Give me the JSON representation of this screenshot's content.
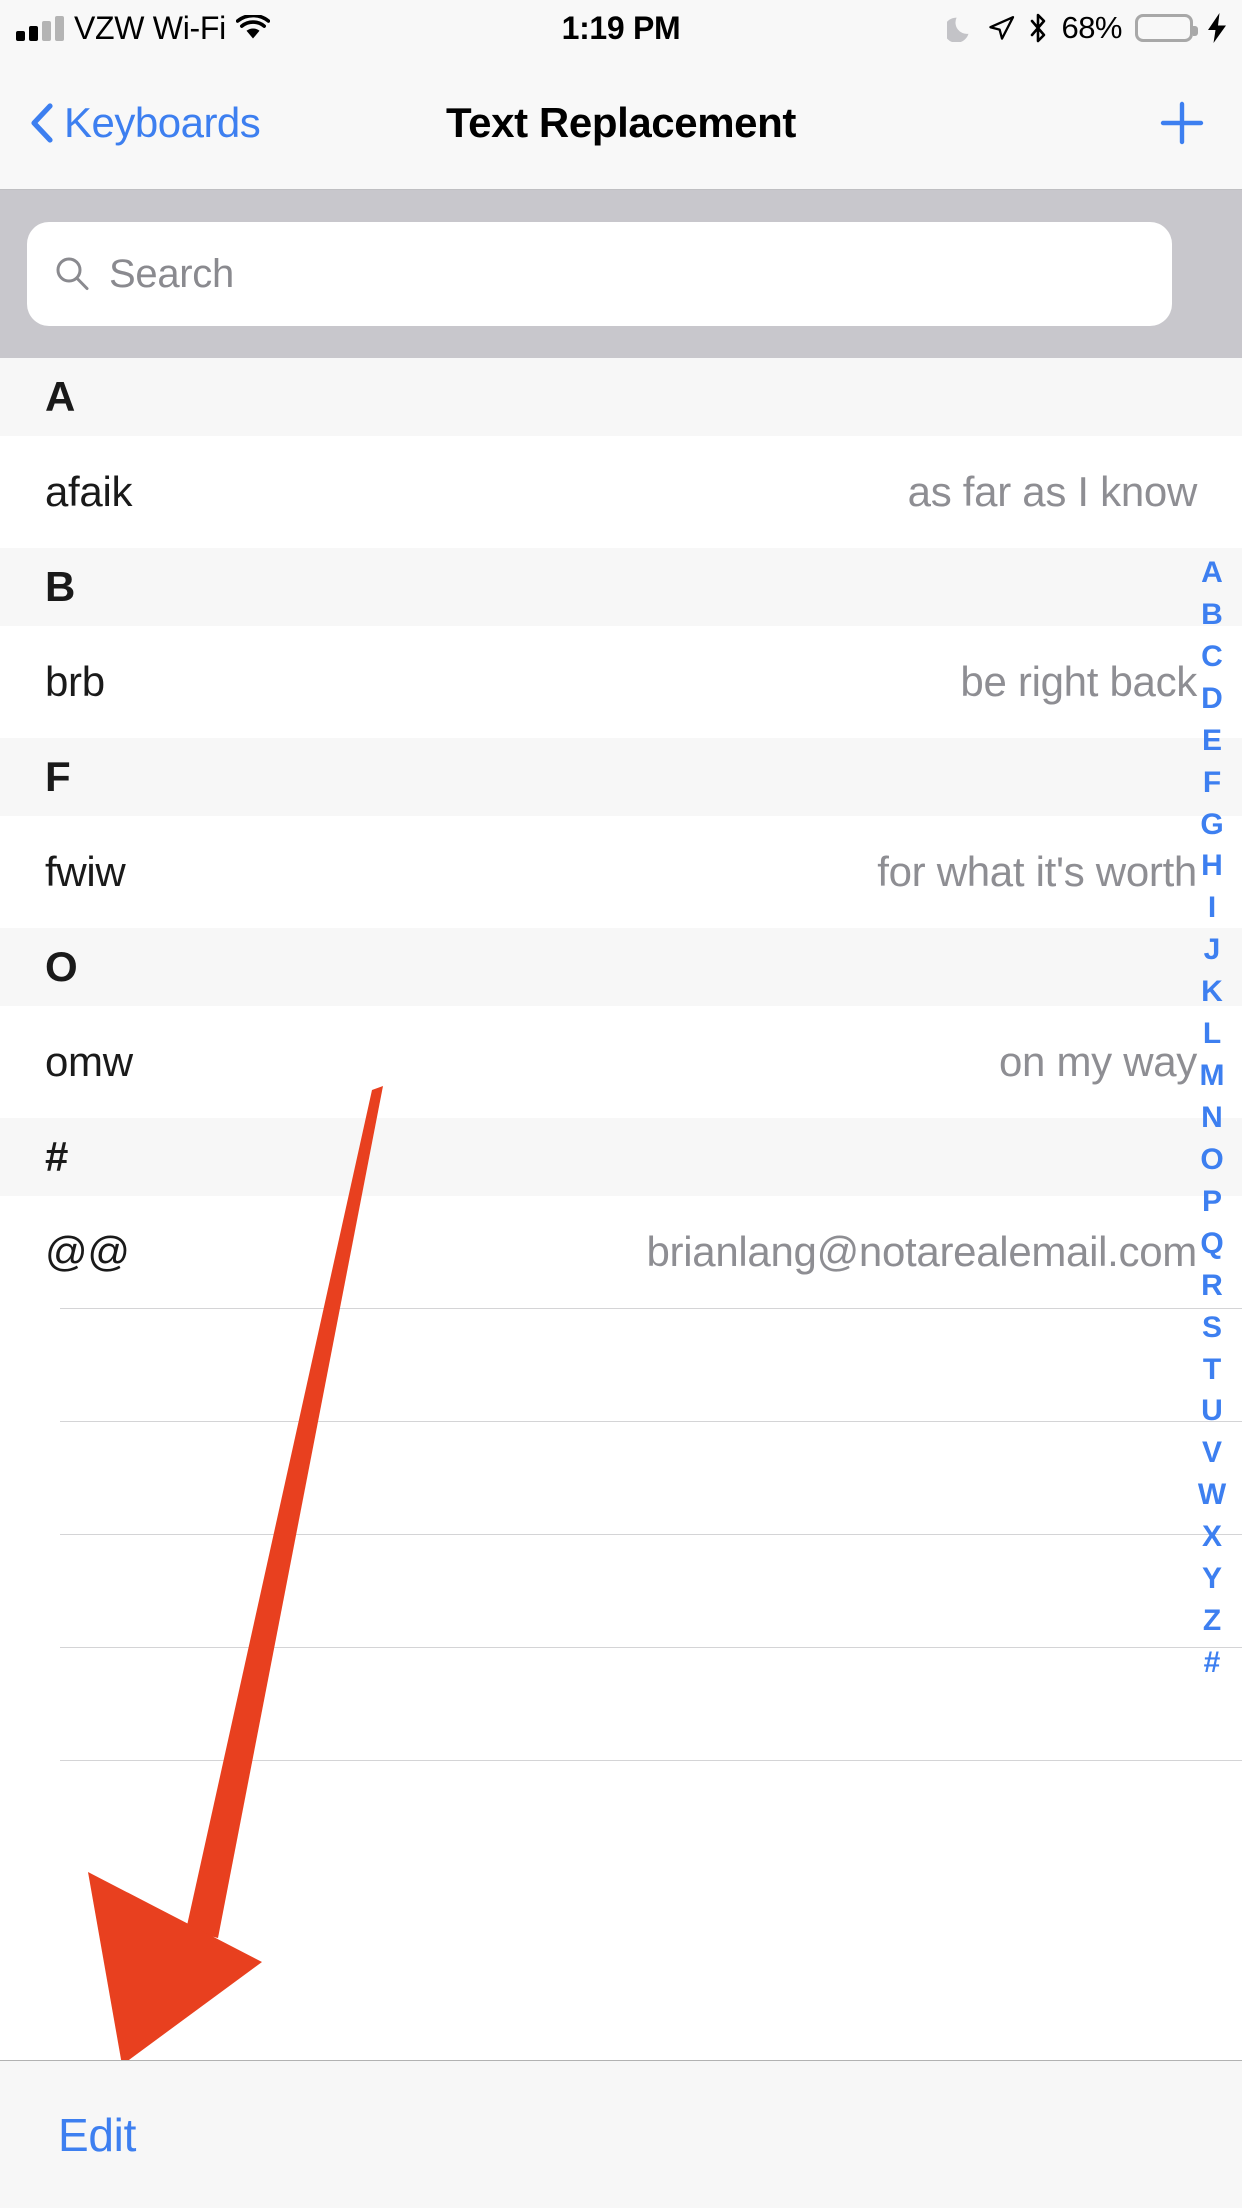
{
  "status_bar": {
    "carrier": "VZW Wi-Fi",
    "time": "1:19 PM",
    "battery_percent": "68%",
    "icons": {
      "signal": "cellular-signal-icon",
      "wifi": "wifi-icon",
      "dnd": "moon-icon",
      "location": "location-arrow-icon",
      "bluetooth": "bluetooth-icon",
      "battery": "battery-icon",
      "charging": "lightning-bolt-icon"
    },
    "battery_fill_color": "#6cd46c"
  },
  "nav_bar": {
    "back_label": "Keyboards",
    "title": "Text Replacement",
    "add_label": "+",
    "tint_color": "#3d7ff0"
  },
  "search": {
    "placeholder": "Search",
    "icon": "search-icon"
  },
  "list": {
    "sections": [
      {
        "header": "A",
        "rows": [
          {
            "shortcut": "afaik",
            "phrase": "as far as I know"
          }
        ]
      },
      {
        "header": "B",
        "rows": [
          {
            "shortcut": "brb",
            "phrase": "be right back"
          }
        ]
      },
      {
        "header": "F",
        "rows": [
          {
            "shortcut": "fwiw",
            "phrase": "for what it's worth"
          }
        ]
      },
      {
        "header": "O",
        "rows": [
          {
            "shortcut": "omw",
            "phrase": "on my way"
          }
        ]
      },
      {
        "header": "#",
        "rows": [
          {
            "shortcut": "@@",
            "phrase": "brianlang@notarealemail.com"
          }
        ]
      }
    ],
    "empty_row_count": 5
  },
  "index_bar": {
    "letters": [
      "A",
      "B",
      "C",
      "D",
      "E",
      "F",
      "G",
      "H",
      "I",
      "J",
      "K",
      "L",
      "M",
      "N",
      "O",
      "P",
      "Q",
      "R",
      "S",
      "T",
      "U",
      "V",
      "W",
      "X",
      "Y",
      "Z",
      "#"
    ],
    "color": "#3d7ff0"
  },
  "toolbar": {
    "edit_label": "Edit"
  },
  "annotation": {
    "type": "arrow",
    "color": "#e8401f",
    "points_to": "Edit",
    "direction": "down-left"
  }
}
